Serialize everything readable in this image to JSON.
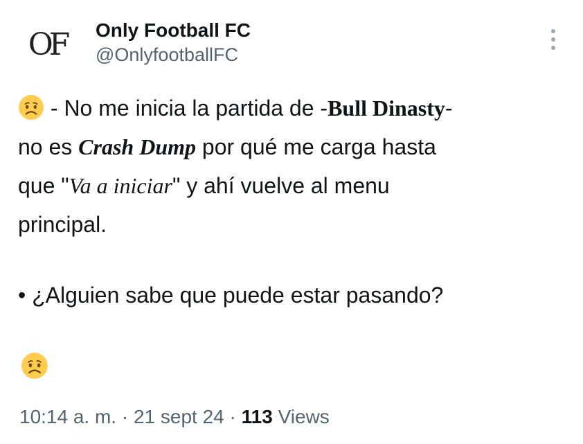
{
  "author": {
    "avatar_text": "OF",
    "display_name": "Only Football FC",
    "handle": "@OnlyfootballFC"
  },
  "menu": {
    "icon": "more-vertical-icon"
  },
  "post": {
    "emoji_icon": "worried-face-icon",
    "line1": {
      "a": " - No me inicia la partida de -",
      "b": "Bull Dinasty",
      "c": "-"
    },
    "line2": {
      "a": "no es ",
      "b": "Crash Dump",
      "c": " por qué me carga hasta"
    },
    "line3": {
      "a": "que \"",
      "b": "Va a iniciar",
      "c": "\"  y ahí vuelve al menu"
    },
    "line4": "principal.",
    "question": "• ¿Alguien sabe que puede estar pasando?"
  },
  "meta": {
    "time": "10:14 a. m.",
    "sep1": " · ",
    "date": "21 sept 24",
    "sep2": " · ",
    "views_count": "113",
    "views_label": " Views"
  },
  "colors": {
    "text": "#0f1419",
    "secondary": "#536471",
    "emoji_face": "#ffcc4d"
  }
}
